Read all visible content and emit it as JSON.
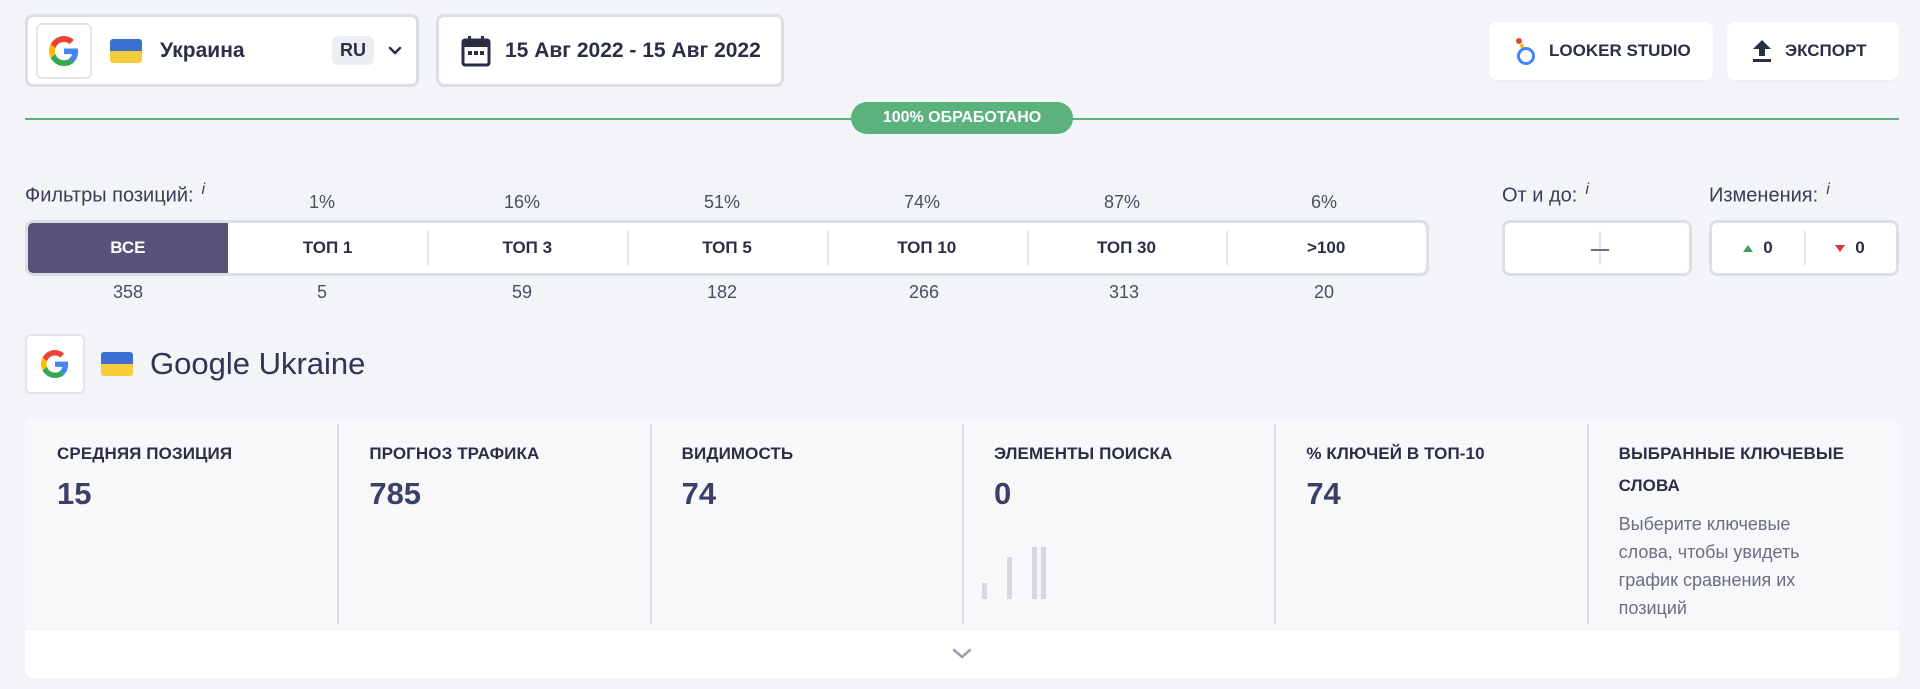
{
  "region": {
    "name": "Украина",
    "lang": "RU"
  },
  "date_range": "15 Авг 2022 - 15 Авг 2022",
  "actions": {
    "looker": "LOOKER STUDIO",
    "export": "ЭКСПОРТ"
  },
  "progress": {
    "label": "100% ОБРАБОТАНО",
    "percent": 100,
    "color": "#5bb27d"
  },
  "filters": {
    "label": "Фильтры позиций:",
    "info": "i",
    "segments": [
      {
        "label": "ВСЕ",
        "percent": "",
        "count": "358"
      },
      {
        "label": "ТОП 1",
        "percent": "1%",
        "count": "5"
      },
      {
        "label": "ТОП 3",
        "percent": "16%",
        "count": "59"
      },
      {
        "label": "ТОП 5",
        "percent": "51%",
        "count": "182"
      },
      {
        "label": "ТОП 10",
        "percent": "74%",
        "count": "266"
      },
      {
        "label": "ТОП 30",
        "percent": "87%",
        "count": "313"
      },
      {
        "label": ">100",
        "percent": "6%",
        "count": "20"
      }
    ],
    "active_color": "#575378"
  },
  "range": {
    "label": "От и до:",
    "info": "i",
    "separator": "—"
  },
  "changes": {
    "label": "Изменения:",
    "info": "i",
    "up": "0",
    "down": "0"
  },
  "engine": {
    "title": "Google Ukraine"
  },
  "metrics": [
    {
      "title": "СРЕДНЯЯ ПОЗИЦИЯ",
      "value": "15"
    },
    {
      "title": "ПРОГНОЗ ТРАФИКА",
      "value": "785"
    },
    {
      "title": "ВИДИМОСТЬ",
      "value": "74"
    },
    {
      "title": "ЭЛЕМЕНТЫ ПОИСКА",
      "value": "0"
    },
    {
      "title": "% КЛЮЧЕЙ В ТОП-10",
      "value": "74"
    },
    {
      "title": "ВЫБРАННЫЕ КЛЮЧЕВЫЕ СЛОВА",
      "desc": "Выберите ключевые слова, чтобы увидеть график сравнения их позиций"
    }
  ]
}
